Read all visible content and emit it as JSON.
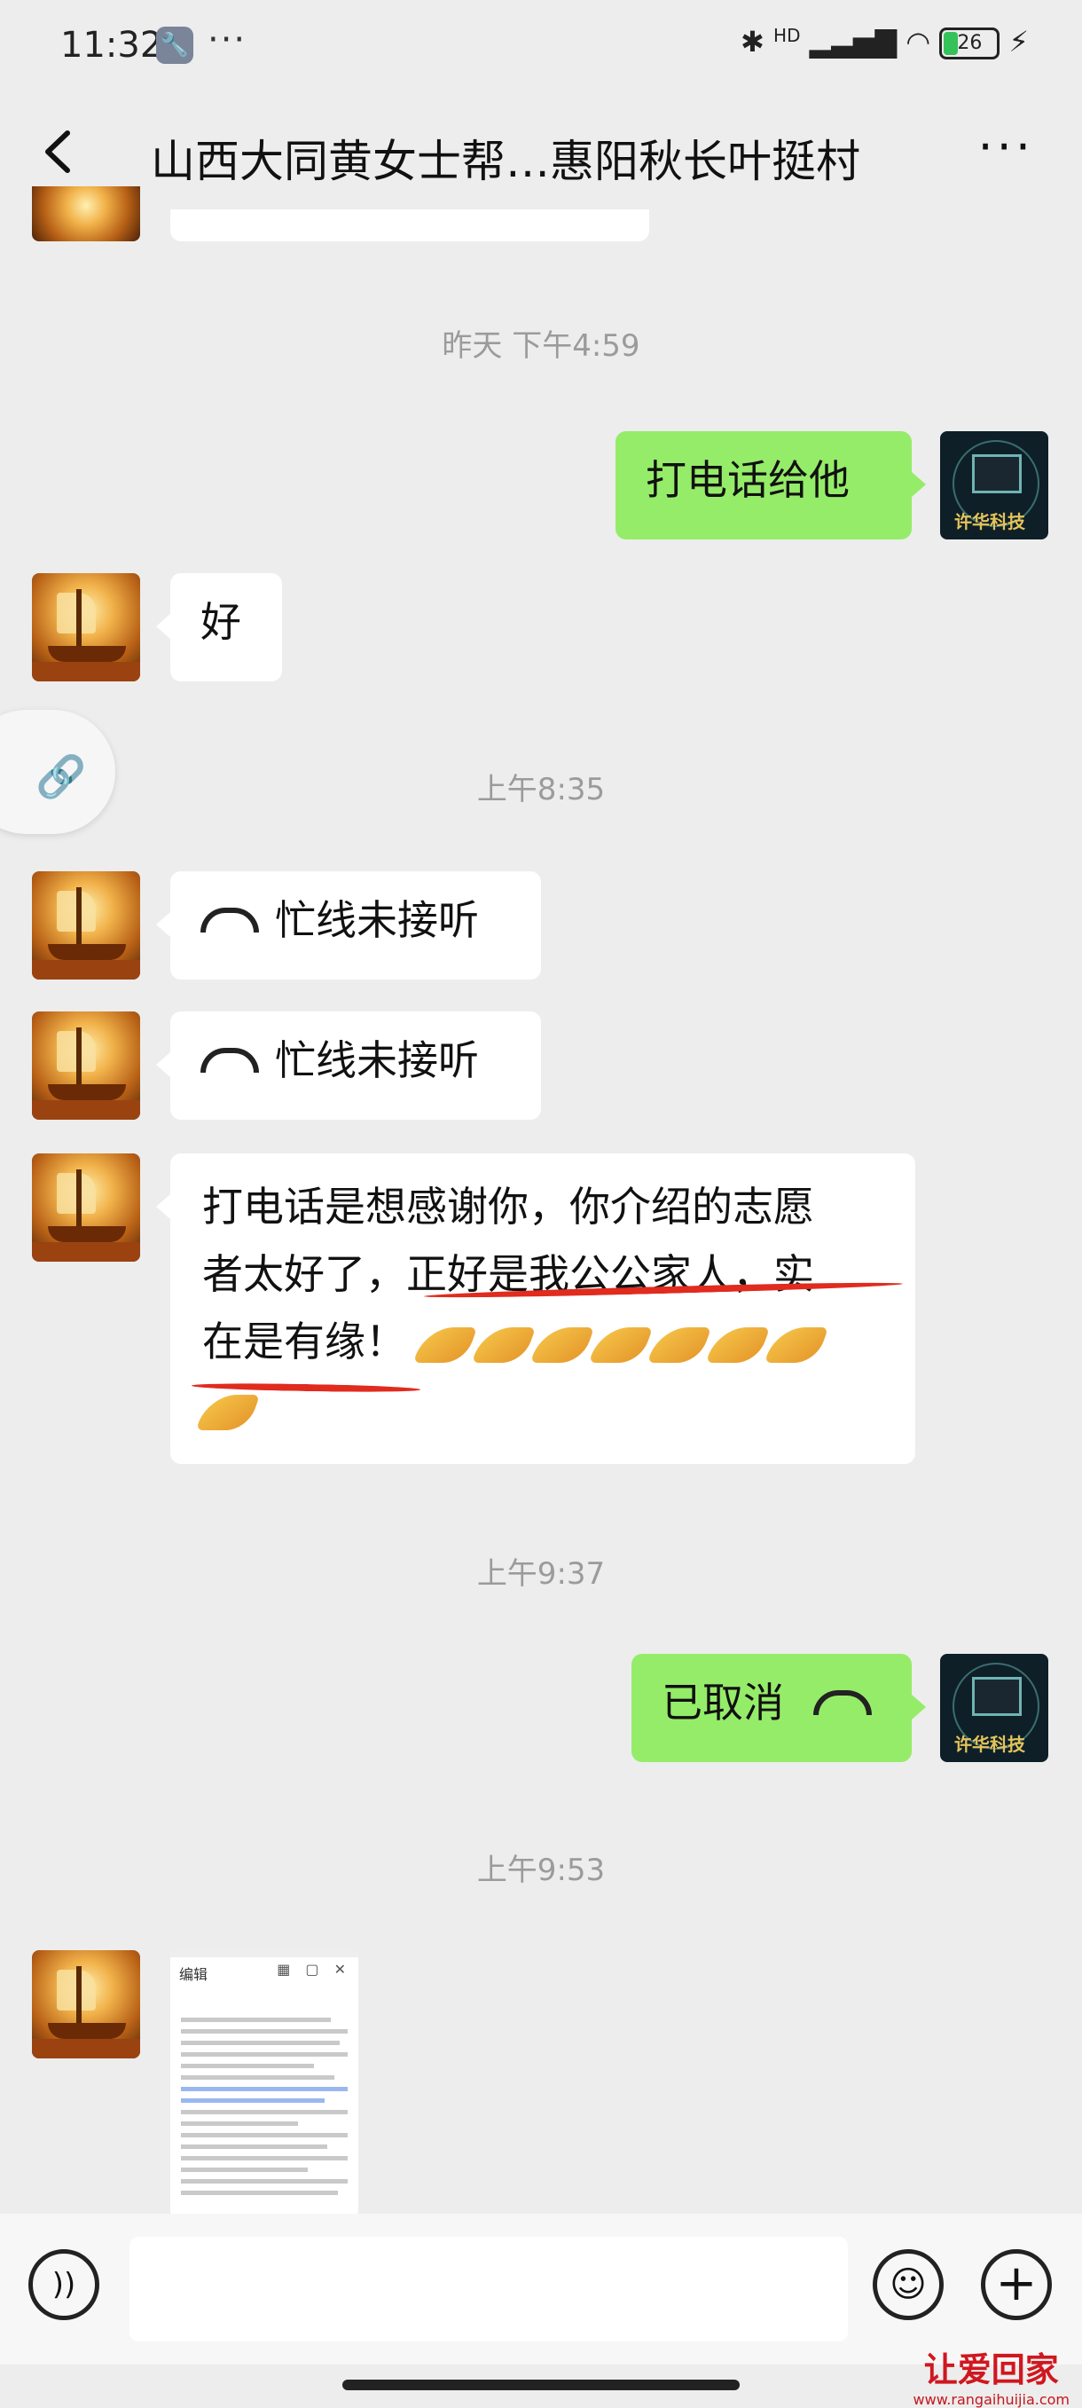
{
  "status": {
    "time": "11:32",
    "signal": "HD",
    "battery": "26"
  },
  "header": {
    "title": "山西大同黄女士帮…惠阳秋长叶挺村"
  },
  "messages": {
    "ts1": "昨天 下午4:59",
    "m1": "打电话给他",
    "m2": "好",
    "ts2": "上午8:35",
    "m3": "忙线未接听",
    "m4": "忙线未接听",
    "m5": {
      "line1": "打电话是想感谢你，你介绍的志愿",
      "line2": "者太好了，正好是我公公家人，实",
      "line3": "在是有缘！"
    },
    "ts3": "上午9:37",
    "m6": "已取消",
    "ts4": "上午9:53"
  },
  "doc": {
    "edit_label": "编辑"
  },
  "avatar_tech_text": "许华科技",
  "watermark": {
    "cn": "让爱回家",
    "url": "www.rangaihuijia.com"
  }
}
